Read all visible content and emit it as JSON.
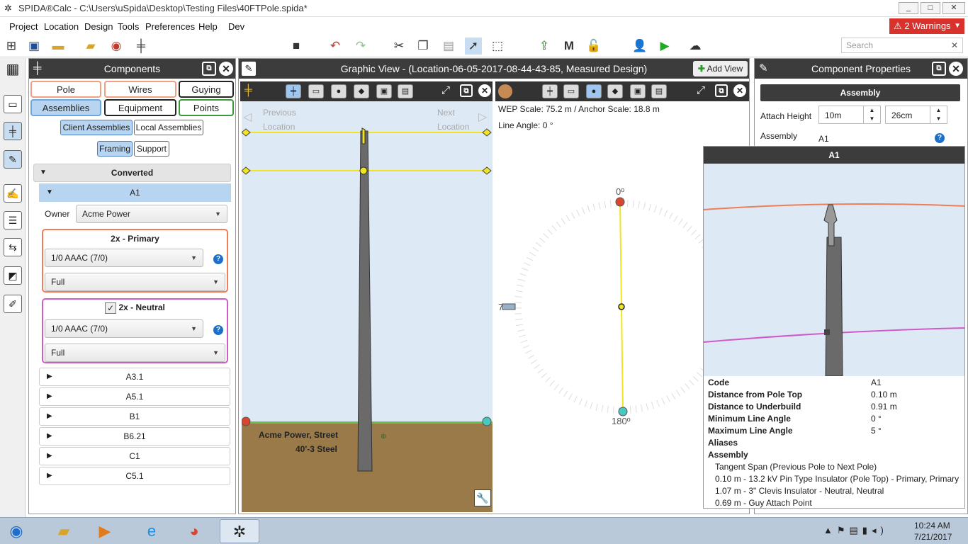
{
  "window": {
    "title": "SPIDA®Calc - C:\\Users\\uSpida\\Desktop\\Testing Files\\40FTPole.spida*",
    "min": "_",
    "max": "□",
    "close": "✕"
  },
  "menu": [
    "Project",
    "Location",
    "Design",
    "Tools",
    "Preferences",
    "Help",
    "Dev"
  ],
  "warnings": "2 Warnings",
  "search": {
    "placeholder": "Search",
    "clear": "✕"
  },
  "components": {
    "title": "Components",
    "tabs": {
      "pole": "Pole",
      "wires": "Wires",
      "guying": "Guying",
      "assemblies": "Assemblies",
      "equipment": "Equipment",
      "points": "Points"
    },
    "client_assemblies": "Client Assemblies",
    "local_assemblies": "Local Assemblies",
    "framing": "Framing",
    "support": "Support",
    "group": "Converted",
    "expanded": "A1",
    "owner_label": "Owner",
    "owner_value": "Acme Power",
    "primary": {
      "title": "2x - Primary",
      "wire": "1/0 AAAC (7/0)",
      "mode": "Full"
    },
    "neutral": {
      "title": "2x - Neutral",
      "wire": "1/0 AAAC (7/0)",
      "mode": "Full"
    },
    "items": [
      "A3.1",
      "A5.1",
      "B1",
      "B6.21",
      "C1",
      "C5.1"
    ]
  },
  "graphic": {
    "title": "Graphic View - (Location-06-05-2017-08-44-43-85, Measured Design)",
    "add_view": "Add View",
    "previous": "Previous",
    "next": "Next",
    "location": "Location",
    "pole_owner": "Acme Power, Street",
    "pole_type": "40'-3 Steel",
    "wep_scale": "WEP Scale: 75.2 m / Anchor Scale: 18.8 m",
    "line_angle": "Line Angle: 0 °",
    "deg0": "0º",
    "deg180": "180º",
    "deg7": "7"
  },
  "props": {
    "title": "Component Properties",
    "header": "Assembly",
    "attach_label": "Attach Height",
    "attach_1": "10m",
    "attach_2": "26cm",
    "assembly_label": "Assembly",
    "assembly_value": "A1"
  },
  "tooltip": {
    "title": "A1",
    "rows": [
      {
        "k": "Code",
        "v": "A1"
      },
      {
        "k": "Distance from Pole Top",
        "v": "0.10 m"
      },
      {
        "k": "Distance to Underbuild",
        "v": "0.91 m"
      },
      {
        "k": "Minimum Line Angle",
        "v": "0 °"
      },
      {
        "k": "Maximum Line Angle",
        "v": "5 °"
      },
      {
        "k": "Aliases",
        "v": ""
      },
      {
        "k": "Assembly",
        "v": ""
      }
    ],
    "assembly_lines": [
      "Tangent Span (Previous Pole to Next Pole)",
      "0.10 m - 13.2 kV Pin Type Insulator (Pole Top) - Primary, Primary",
      "1.07 m - 3\" Clevis Insulator - Neutral, Neutral",
      "0.69 m - Guy Attach Point"
    ]
  },
  "clock": {
    "time": "10:24 AM",
    "date": "7/21/2017"
  },
  "colors": {
    "primary": "#f07c5a",
    "neutral": "#d05bc8",
    "warning": "#d9322c",
    "sky": "#dde9f5",
    "ground": "#9a7a48"
  }
}
